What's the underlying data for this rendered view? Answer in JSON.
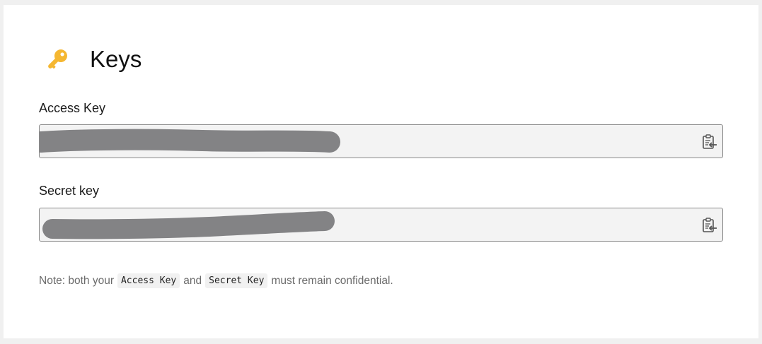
{
  "header": {
    "icon": "key-icon",
    "title": "Keys"
  },
  "access_key": {
    "label": "Access Key",
    "value": "",
    "copy_icon": "clipboard-copy-icon"
  },
  "secret_key": {
    "label": "Secret key",
    "value": "",
    "copy_icon": "clipboard-copy-icon"
  },
  "note": {
    "prefix": "Note: both your",
    "code1": "Access Key",
    "middle": "and",
    "code2": "Secret Key",
    "suffix": "must remain confidential."
  },
  "colors": {
    "key_icon": "#f5b731",
    "redaction": "#838385",
    "field_bg": "#f3f3f3"
  }
}
